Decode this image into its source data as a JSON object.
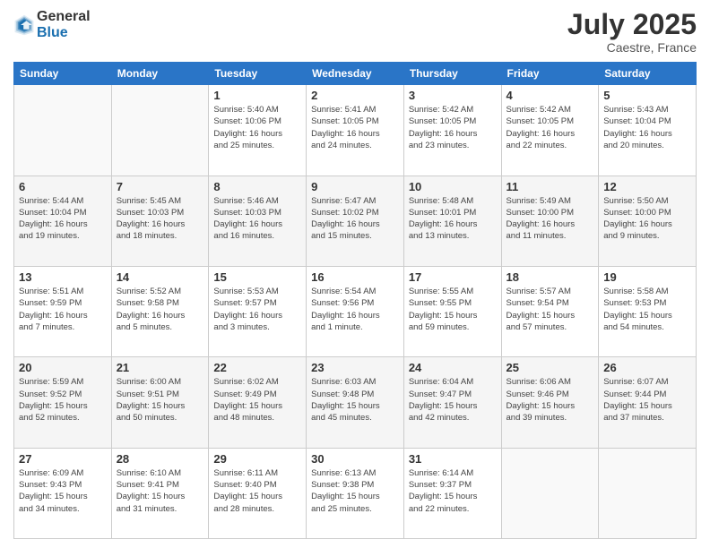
{
  "logo": {
    "general": "General",
    "blue": "Blue"
  },
  "title": "July 2025",
  "location": "Caestre, France",
  "days_header": [
    "Sunday",
    "Monday",
    "Tuesday",
    "Wednesday",
    "Thursday",
    "Friday",
    "Saturday"
  ],
  "weeks": [
    [
      {
        "day": "",
        "info": ""
      },
      {
        "day": "",
        "info": ""
      },
      {
        "day": "1",
        "info": "Sunrise: 5:40 AM\nSunset: 10:06 PM\nDaylight: 16 hours\nand 25 minutes."
      },
      {
        "day": "2",
        "info": "Sunrise: 5:41 AM\nSunset: 10:05 PM\nDaylight: 16 hours\nand 24 minutes."
      },
      {
        "day": "3",
        "info": "Sunrise: 5:42 AM\nSunset: 10:05 PM\nDaylight: 16 hours\nand 23 minutes."
      },
      {
        "day": "4",
        "info": "Sunrise: 5:42 AM\nSunset: 10:05 PM\nDaylight: 16 hours\nand 22 minutes."
      },
      {
        "day": "5",
        "info": "Sunrise: 5:43 AM\nSunset: 10:04 PM\nDaylight: 16 hours\nand 20 minutes."
      }
    ],
    [
      {
        "day": "6",
        "info": "Sunrise: 5:44 AM\nSunset: 10:04 PM\nDaylight: 16 hours\nand 19 minutes."
      },
      {
        "day": "7",
        "info": "Sunrise: 5:45 AM\nSunset: 10:03 PM\nDaylight: 16 hours\nand 18 minutes."
      },
      {
        "day": "8",
        "info": "Sunrise: 5:46 AM\nSunset: 10:03 PM\nDaylight: 16 hours\nand 16 minutes."
      },
      {
        "day": "9",
        "info": "Sunrise: 5:47 AM\nSunset: 10:02 PM\nDaylight: 16 hours\nand 15 minutes."
      },
      {
        "day": "10",
        "info": "Sunrise: 5:48 AM\nSunset: 10:01 PM\nDaylight: 16 hours\nand 13 minutes."
      },
      {
        "day": "11",
        "info": "Sunrise: 5:49 AM\nSunset: 10:00 PM\nDaylight: 16 hours\nand 11 minutes."
      },
      {
        "day": "12",
        "info": "Sunrise: 5:50 AM\nSunset: 10:00 PM\nDaylight: 16 hours\nand 9 minutes."
      }
    ],
    [
      {
        "day": "13",
        "info": "Sunrise: 5:51 AM\nSunset: 9:59 PM\nDaylight: 16 hours\nand 7 minutes."
      },
      {
        "day": "14",
        "info": "Sunrise: 5:52 AM\nSunset: 9:58 PM\nDaylight: 16 hours\nand 5 minutes."
      },
      {
        "day": "15",
        "info": "Sunrise: 5:53 AM\nSunset: 9:57 PM\nDaylight: 16 hours\nand 3 minutes."
      },
      {
        "day": "16",
        "info": "Sunrise: 5:54 AM\nSunset: 9:56 PM\nDaylight: 16 hours\nand 1 minute."
      },
      {
        "day": "17",
        "info": "Sunrise: 5:55 AM\nSunset: 9:55 PM\nDaylight: 15 hours\nand 59 minutes."
      },
      {
        "day": "18",
        "info": "Sunrise: 5:57 AM\nSunset: 9:54 PM\nDaylight: 15 hours\nand 57 minutes."
      },
      {
        "day": "19",
        "info": "Sunrise: 5:58 AM\nSunset: 9:53 PM\nDaylight: 15 hours\nand 54 minutes."
      }
    ],
    [
      {
        "day": "20",
        "info": "Sunrise: 5:59 AM\nSunset: 9:52 PM\nDaylight: 15 hours\nand 52 minutes."
      },
      {
        "day": "21",
        "info": "Sunrise: 6:00 AM\nSunset: 9:51 PM\nDaylight: 15 hours\nand 50 minutes."
      },
      {
        "day": "22",
        "info": "Sunrise: 6:02 AM\nSunset: 9:49 PM\nDaylight: 15 hours\nand 48 minutes."
      },
      {
        "day": "23",
        "info": "Sunrise: 6:03 AM\nSunset: 9:48 PM\nDaylight: 15 hours\nand 45 minutes."
      },
      {
        "day": "24",
        "info": "Sunrise: 6:04 AM\nSunset: 9:47 PM\nDaylight: 15 hours\nand 42 minutes."
      },
      {
        "day": "25",
        "info": "Sunrise: 6:06 AM\nSunset: 9:46 PM\nDaylight: 15 hours\nand 39 minutes."
      },
      {
        "day": "26",
        "info": "Sunrise: 6:07 AM\nSunset: 9:44 PM\nDaylight: 15 hours\nand 37 minutes."
      }
    ],
    [
      {
        "day": "27",
        "info": "Sunrise: 6:09 AM\nSunset: 9:43 PM\nDaylight: 15 hours\nand 34 minutes."
      },
      {
        "day": "28",
        "info": "Sunrise: 6:10 AM\nSunset: 9:41 PM\nDaylight: 15 hours\nand 31 minutes."
      },
      {
        "day": "29",
        "info": "Sunrise: 6:11 AM\nSunset: 9:40 PM\nDaylight: 15 hours\nand 28 minutes."
      },
      {
        "day": "30",
        "info": "Sunrise: 6:13 AM\nSunset: 9:38 PM\nDaylight: 15 hours\nand 25 minutes."
      },
      {
        "day": "31",
        "info": "Sunrise: 6:14 AM\nSunset: 9:37 PM\nDaylight: 15 hours\nand 22 minutes."
      },
      {
        "day": "",
        "info": ""
      },
      {
        "day": "",
        "info": ""
      }
    ]
  ]
}
